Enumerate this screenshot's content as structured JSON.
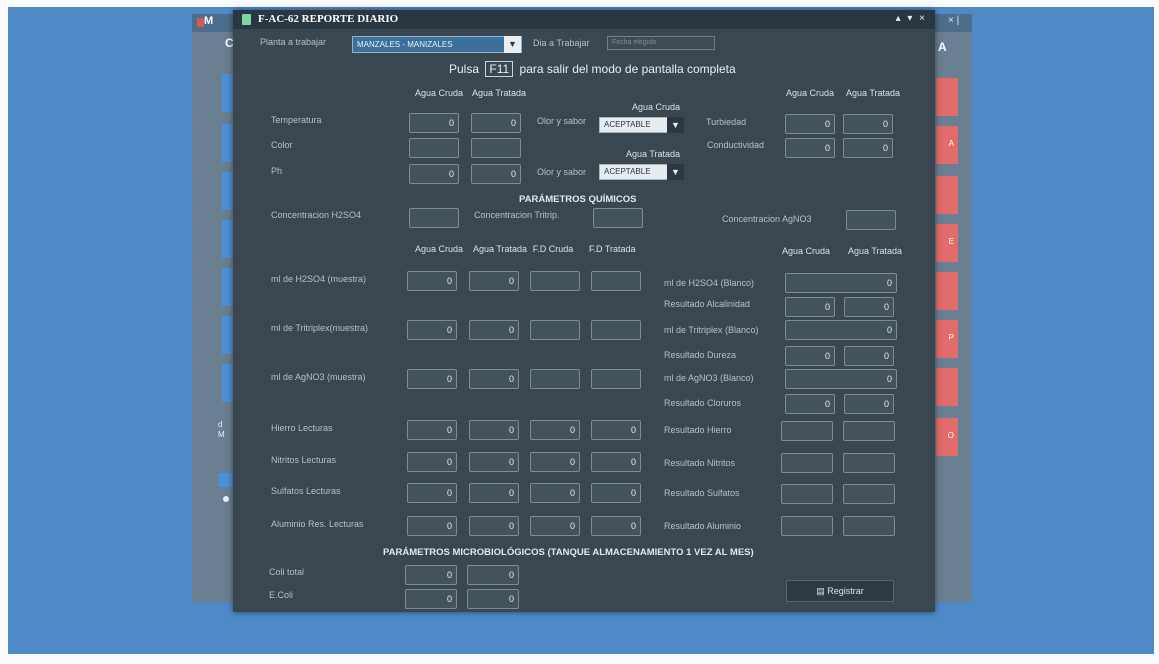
{
  "background_app": {
    "title": "M",
    "header_left": "C",
    "header_right": "A",
    "close": "× |",
    "side_text_1": "d",
    "side_text_2": "M",
    "right_button_labels": [
      "",
      "A",
      "",
      "E",
      "",
      "P",
      "",
      "O",
      ""
    ]
  },
  "window": {
    "title": "F-AC-62 REPORTE DIARIO",
    "controls": "▴ ▾ ×"
  },
  "top": {
    "planta_label": "Planta a trabajar",
    "planta_value": "MANZALES - MANIZALES",
    "dia_label": "Dia a Trabajar",
    "dia_placeholder": "Fecha elegida"
  },
  "banner": {
    "prefix": "Pulsa",
    "key": "F11",
    "suffix": "para salir del modo de pantalla completa"
  },
  "physical": {
    "hdr_agua_cruda": "Agua Cruda",
    "hdr_agua_tratada": "Agua Tratada",
    "temperatura": "Temperatura",
    "color": "Color",
    "ph": "Ph",
    "olor_sabor_1": "Olor y sabor",
    "olor_sabor_2": "Olor y sabor",
    "agua_cruda_label": "Agua Cruda",
    "agua_tratada_label": "Agua Tratada",
    "olor_cruda_value": "ACEPTABLE",
    "olor_tratada_value": "ACEPTABLE",
    "turbiedad": "Turbiedad",
    "conductividad": "Conductividad",
    "zero": "0"
  },
  "chemical": {
    "title": "PARÁMETROS QUÍMICOS",
    "conc_h2so4": "Concentracion H2SO4",
    "conc_tritrip": "Concentracion Tritrip.",
    "conc_agno3": "Concentracion AgNO3",
    "hdr_agua_cruda": "Agua Cruda",
    "hdr_agua_tratada": "Agua Tratada",
    "hdr_fd_cruda": "F.D Cruda",
    "hdr_fd_tratada": "F.D Tratada",
    "rows_left": [
      "ml de H2SO4 (muestra)",
      "ml de Tritriplex(muestra)",
      "ml de AgNO3 (muestra)",
      "Hierro Lecturas",
      "Nitritos Lecturas",
      "Sulfatos Lecturas",
      "Aluminio Res. Lecturas"
    ],
    "rows_right": [
      "ml de H2SO4 (Blanco)",
      "Resultado Alcalinidad",
      "ml de Tritriplex (Blanco)",
      "Resultado Dureza",
      "ml de AgNO3 (Blanco)",
      "Resultado Cloruros",
      "Resultado Hierro",
      "Resultado Nitritos",
      "Resultado Sulfatos",
      "Resultado Aluminio"
    ]
  },
  "micro": {
    "title": "PARÁMETROS MICROBIOLÓGICOS (TANQUE ALMACENAMIENTO 1 VEZ AL MES)",
    "coli_total": "Coli total",
    "e_coli": "E.Coli"
  },
  "actions": {
    "registrar": "Registrar",
    "save_icon": "floppy-disk-icon"
  },
  "colors": {
    "desktop": "#4f8ac7",
    "window_bg": "#3a4650",
    "title_bar": "#2a3742",
    "accent_red": "#e26c6c"
  }
}
